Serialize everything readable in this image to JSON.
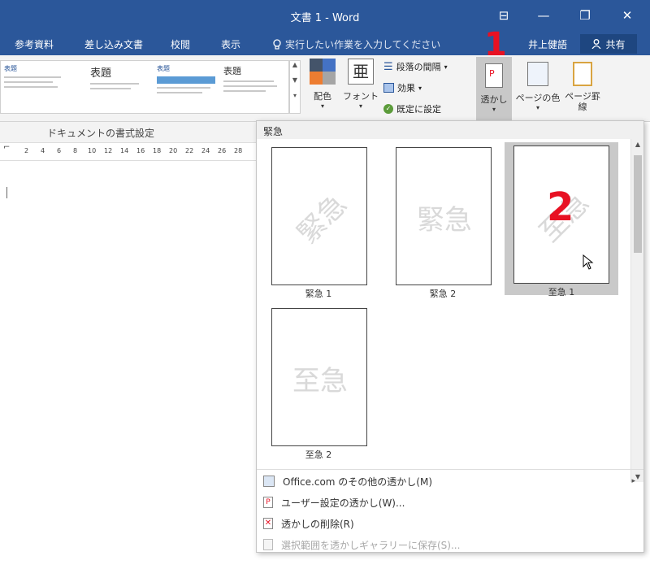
{
  "window": {
    "title": "文書 1 - Word",
    "buttons": {
      "ribbon_display": "⊟",
      "minimize": "—",
      "restore": "❐",
      "close": "✕"
    }
  },
  "tabs": [
    "参考資料",
    "差し込み文書",
    "校閲",
    "表示"
  ],
  "tell_me": {
    "icon": "lightbulb-icon",
    "placeholder": "実行したい作業を入力してください"
  },
  "user": {
    "name": "井上健語"
  },
  "share": {
    "label": "共有",
    "icon": "person-icon"
  },
  "style_gallery": [
    {
      "title": "表題"
    },
    {
      "title": "表題"
    },
    {
      "title": "表題"
    },
    {
      "title": "表題"
    }
  ],
  "ribbon": {
    "colors_label": "配色",
    "fonts_label": "フォント",
    "paragraph_spacing_label": "段落の間隔",
    "effects_label": "効果",
    "set_default_label": "既定に設定",
    "watermark_label": "透かし",
    "page_color_label": "ページの色",
    "page_borders_label": "ページ罫線"
  },
  "document": {
    "format_label": "ドキュメントの書式設定"
  },
  "ruler_ticks": [
    "2",
    "4",
    "6",
    "8",
    "10",
    "12",
    "14",
    "16",
    "18",
    "20",
    "22",
    "24",
    "26",
    "28"
  ],
  "callouts": [
    "1",
    "2"
  ],
  "dropdown": {
    "header": "緊急",
    "thumbnails": [
      {
        "label": "緊急 1",
        "watermark": "緊急",
        "style": "diagonal",
        "selected": false
      },
      {
        "label": "緊急 2",
        "watermark": "緊急",
        "style": "horizontal",
        "selected": false
      },
      {
        "label": "至急 1",
        "watermark": "至急",
        "style": "diagonal",
        "selected": true
      },
      {
        "label": "至急 2",
        "watermark": "至急",
        "style": "horizontal",
        "selected": false
      }
    ],
    "menu": [
      {
        "label": "Office.com のその他の透かし(M)",
        "icon": "office-watermark-icon",
        "disabled": false,
        "has_submenu": true
      },
      {
        "label": "ユーザー設定の透かし(W)...",
        "icon": "custom-watermark-icon",
        "disabled": false,
        "has_submenu": false
      },
      {
        "label": "透かしの削除(R)",
        "icon": "remove-watermark-icon",
        "disabled": false,
        "has_submenu": false
      },
      {
        "label": "選択範囲を透かしギャラリーに保存(S)...",
        "icon": "save-watermark-icon",
        "disabled": true,
        "has_submenu": false
      }
    ]
  },
  "colors": {
    "title_bar": "#2b579a",
    "callout": "#e81123",
    "selection": "#c9c9c9"
  }
}
